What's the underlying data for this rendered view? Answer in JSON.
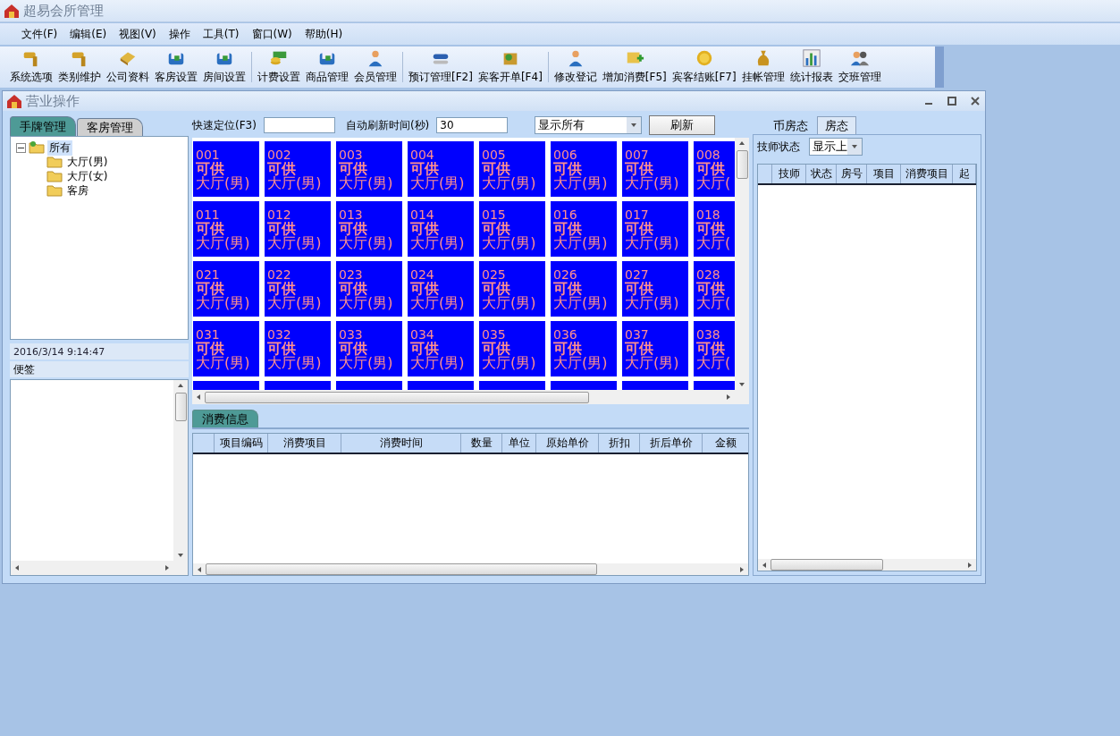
{
  "window": {
    "title": "超易会所管理"
  },
  "menu": [
    "文件(F)",
    "编辑(E)",
    "视图(V)",
    "操作",
    "工具(T)",
    "窗口(W)",
    "帮助(H)"
  ],
  "toolbar": [
    [
      {
        "label": "系统选项"
      },
      {
        "label": "类别维护"
      },
      {
        "label": "公司资料"
      },
      {
        "label": "客房设置"
      },
      {
        "label": "房间设置"
      }
    ],
    [
      {
        "label": "计费设置"
      },
      {
        "label": "商品管理"
      },
      {
        "label": "会员管理"
      }
    ],
    [
      {
        "label": "预订管理[F2]"
      },
      {
        "label": "宾客开单[F4]"
      }
    ],
    [
      {
        "label": "修改登记"
      },
      {
        "label": "增加消费[F5]"
      },
      {
        "label": "宾客结账[F7]"
      },
      {
        "label": "挂帐管理"
      },
      {
        "label": "统计报表"
      },
      {
        "label": "交班管理"
      }
    ]
  ],
  "child_window": {
    "title": "营业操作"
  },
  "left_tabs": [
    {
      "label": "手牌管理",
      "selected": true
    },
    {
      "label": "客房管理",
      "selected": false
    }
  ],
  "tree": [
    {
      "label": "所有",
      "expanded": true,
      "selected": true,
      "children": [
        {
          "label": "大厅(男)",
          "selected": false
        },
        {
          "label": "大厅(女)",
          "selected": false
        },
        {
          "label": "客房",
          "selected": false
        }
      ]
    }
  ],
  "datetime": "2016/3/14 9:14:47",
  "notes": {
    "title": "便签"
  },
  "controls": {
    "locate_label": "快速定位(F3)",
    "refresh_label": "自动刷新时间(秒)",
    "refresh_value": "30",
    "filter_value": "显示所有",
    "refresh_button": "刷新"
  },
  "rooms": [
    [
      {
        "kind": "full",
        "number": "001",
        "status": "可供",
        "area": "大厅(男)"
      },
      {
        "kind": "full",
        "number": "002",
        "status": "可供",
        "area": "大厅(男)"
      },
      {
        "kind": "full",
        "number": "003",
        "status": "可供",
        "area": "大厅(男)"
      },
      {
        "kind": "full",
        "number": "004",
        "status": "可供",
        "area": "大厅(男)"
      },
      {
        "kind": "full",
        "number": "005",
        "status": "可供",
        "area": "大厅(男)"
      },
      {
        "kind": "full",
        "number": "006",
        "status": "可供",
        "area": "大厅(男)"
      },
      {
        "kind": "full",
        "number": "007",
        "status": "可供",
        "area": "大厅(男)"
      },
      {
        "kind": "cut_right",
        "number": "008",
        "status": "可供",
        "area": "大厅("
      }
    ],
    [
      {
        "kind": "full",
        "number": "011",
        "status": "可供",
        "area": "大厅(男)"
      },
      {
        "kind": "full",
        "number": "012",
        "status": "可供",
        "area": "大厅(男)"
      },
      {
        "kind": "full",
        "number": "013",
        "status": "可供",
        "area": "大厅(男)"
      },
      {
        "kind": "full",
        "number": "014",
        "status": "可供",
        "area": "大厅(男)"
      },
      {
        "kind": "full",
        "number": "015",
        "status": "可供",
        "area": "大厅(男)"
      },
      {
        "kind": "full",
        "number": "016",
        "status": "可供",
        "area": "大厅(男)"
      },
      {
        "kind": "full",
        "number": "017",
        "status": "可供",
        "area": "大厅(男)"
      },
      {
        "kind": "cut_right",
        "number": "018",
        "status": "可供",
        "area": "大厅("
      }
    ],
    [
      {
        "kind": "full",
        "number": "021",
        "status": "可供",
        "area": "大厅(男)"
      },
      {
        "kind": "full",
        "number": "022",
        "status": "可供",
        "area": "大厅(男)"
      },
      {
        "kind": "full",
        "number": "023",
        "status": "可供",
        "area": "大厅(男)"
      },
      {
        "kind": "full",
        "number": "024",
        "status": "可供",
        "area": "大厅(男)"
      },
      {
        "kind": "full",
        "number": "025",
        "status": "可供",
        "area": "大厅(男)"
      },
      {
        "kind": "full",
        "number": "026",
        "status": "可供",
        "area": "大厅(男)"
      },
      {
        "kind": "full",
        "number": "027",
        "status": "可供",
        "area": "大厅(男)"
      },
      {
        "kind": "cut_right",
        "number": "028",
        "status": "可供",
        "area": "大厅("
      }
    ],
    [
      {
        "kind": "full",
        "number": "031",
        "status": "可供",
        "area": "大厅(男)"
      },
      {
        "kind": "full",
        "number": "032",
        "status": "可供",
        "area": "大厅(男)"
      },
      {
        "kind": "full",
        "number": "033",
        "status": "可供",
        "area": "大厅(男)"
      },
      {
        "kind": "full",
        "number": "034",
        "status": "可供",
        "area": "大厅(男)"
      },
      {
        "kind": "full",
        "number": "035",
        "status": "可供",
        "area": "大厅(男)"
      },
      {
        "kind": "full",
        "number": "036",
        "status": "可供",
        "area": "大厅(男)"
      },
      {
        "kind": "full",
        "number": "037",
        "status": "可供",
        "area": "大厅(男)"
      },
      {
        "kind": "cut_right",
        "number": "038",
        "status": "可供",
        "area": "大厅("
      }
    ],
    [
      {
        "kind": "cut_bottom"
      },
      {
        "kind": "cut_bottom"
      },
      {
        "kind": "cut_bottom"
      },
      {
        "kind": "cut_bottom"
      },
      {
        "kind": "cut_bottom"
      },
      {
        "kind": "cut_bottom"
      },
      {
        "kind": "cut_bottom"
      },
      {
        "kind": "cut_corner"
      }
    ]
  ],
  "consumption": {
    "tab": "消费信息",
    "columns": [
      "项目编码",
      "消费项目",
      "消费时间",
      "数量",
      "单位",
      "原始单价",
      "折扣",
      "折后单价",
      "金额"
    ]
  },
  "right_tabs": [
    {
      "label": "币房态",
      "selected": true
    },
    {
      "label": "房态",
      "selected": false
    }
  ],
  "technician": {
    "label": "技师状态",
    "filter_value": "显示上",
    "columns": [
      "技师",
      "状态",
      "房号",
      "项目",
      "消费项目",
      "起"
    ]
  }
}
